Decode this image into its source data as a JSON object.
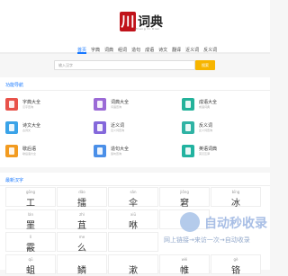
{
  "header": {
    "logo_mark": "川",
    "logo_text": "词典",
    "logo_sub": "Zheng Ci Dian",
    "nav": [
      "首页",
      "字典",
      "词典",
      "组词",
      "造句",
      "成语",
      "诗文",
      "翻译",
      "近义词",
      "反义词"
    ]
  },
  "search": {
    "placeholder": "输入汉字",
    "button": "搜索"
  },
  "tools": {
    "title": "功能导航",
    "items": [
      {
        "name": "字典大全",
        "desc": "汉字查询",
        "color": "#e8524a"
      },
      {
        "name": "词典大全",
        "desc": "词语查询",
        "color": "#9b6ad6"
      },
      {
        "name": "成语大全",
        "desc": "成语词典",
        "color": "#24b29a"
      },
      {
        "name": "诗文大全",
        "desc": "古诗文",
        "color": "#3aa3e8"
      },
      {
        "name": "近义词",
        "desc": "近义词查询",
        "color": "#8468db"
      },
      {
        "name": "反义词",
        "desc": "反义词查询",
        "color": "#2fb3a4"
      },
      {
        "name": "歇后语",
        "desc": "歇后语大全",
        "color": "#f29b20"
      },
      {
        "name": "造句大全",
        "desc": "造句查询",
        "color": "#4a8fe8"
      },
      {
        "name": "英语词典",
        "desc": "英汉互译",
        "color": "#22b3a0"
      }
    ]
  },
  "latest": {
    "title": "最新汉字",
    "rows": [
      [
        {
          "py": "gōng",
          "ch": "工"
        },
        {
          "py": "dǎo",
          "ch": "擂"
        },
        {
          "py": "sǎn",
          "ch": "伞"
        },
        {
          "py": "jiǒng",
          "ch": "窘"
        },
        {
          "py": "bīng",
          "ch": "冰"
        }
      ],
      [
        {
          "py": "lán",
          "ch": "罣"
        },
        {
          "py": "zhì",
          "ch": "苴"
        },
        {
          "py": "xiū",
          "ch": "咻"
        },
        {
          "py": "",
          "ch": ""
        },
        {
          "py": "",
          "ch": ""
        }
      ],
      [
        {
          "py": "lì",
          "ch": "霰"
        },
        {
          "py": "me",
          "ch": "么"
        },
        {
          "py": "",
          "ch": ""
        },
        {
          "py": "",
          "ch": ""
        },
        {
          "py": "",
          "ch": ""
        }
      ],
      [
        {
          "py": "qū",
          "ch": "蛆"
        },
        {
          "py": "",
          "ch": "鳞"
        },
        {
          "py": "",
          "ch": "漱"
        },
        {
          "py": "wèi",
          "ch": "帷"
        },
        {
          "py": "gè",
          "ch": "铬"
        }
      ]
    ]
  },
  "watermark": {
    "title": "自动秒收录",
    "subtitle": "网上链接→来访一次→自动收录"
  }
}
